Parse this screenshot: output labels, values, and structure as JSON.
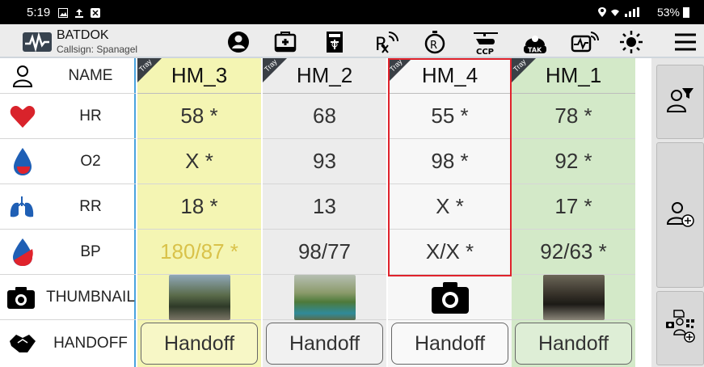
{
  "status": {
    "time": "5:19",
    "battery": "53%"
  },
  "app": {
    "title": "BATDOK",
    "callsign": "Callsign: Spanagel"
  },
  "toolbar": {
    "icons": [
      "account-icon",
      "medical-bag-icon",
      "medical-card-icon",
      "rx-signal-icon",
      "rx-timer-icon",
      "ccp-helicopter-icon",
      "tak-icon",
      "vitals-monitor-icon",
      "brightness-icon",
      "menu-icon"
    ],
    "ccp_label": "CCP",
    "tak_label": "TAK"
  },
  "rows": [
    {
      "label": "NAME",
      "icon": "person-outline-icon"
    },
    {
      "label": "HR",
      "icon": "heart-icon"
    },
    {
      "label": "O2",
      "icon": "blood-drop-icon"
    },
    {
      "label": "RR",
      "icon": "lungs-icon"
    },
    {
      "label": "BP",
      "icon": "blood-pressure-icon"
    },
    {
      "label": "THUMBNAIL",
      "icon": "camera-icon"
    },
    {
      "label": "HANDOFF",
      "icon": "handshake-icon"
    }
  ],
  "tray_label": "Tray",
  "patients": [
    {
      "name": "HM_3",
      "hr": "58 *",
      "o2": "X *",
      "rr": "18 *",
      "bp": "180/87 *",
      "bp_color": "#d9c24a",
      "bg": "#f4f5b3",
      "thumbnail": "photo",
      "handoff": "Handoff"
    },
    {
      "name": "HM_2",
      "hr": "68",
      "o2": "93",
      "rr": "13",
      "bp": "98/77",
      "bp_color": "#333333",
      "bg": "#ececec",
      "thumbnail": "photo",
      "handoff": "Handoff"
    },
    {
      "name": "HM_4",
      "hr": "55 *",
      "o2": "98 *",
      "rr": "X *",
      "bp": "X/X *",
      "bp_color": "#333333",
      "bg": "#f7f7f7",
      "thumbnail": "camera",
      "handoff": "Handoff"
    },
    {
      "name": "HM_1",
      "hr": "78 *",
      "o2": "92 *",
      "rr": "17 *",
      "bp": "92/63 *",
      "bp_color": "#333333",
      "bg": "#d3e9c8",
      "thumbnail": "photo",
      "handoff": "Handoff"
    }
  ],
  "colors": {
    "selected_border": "#e0232c",
    "accent_blue": "#4aa3df",
    "heart": "#d9232b",
    "drop": "#1f5fb5"
  },
  "sidebar": {
    "buttons": [
      "filter-patients-icon",
      "add-patient-icon",
      "scan-add-patient-icon"
    ]
  }
}
